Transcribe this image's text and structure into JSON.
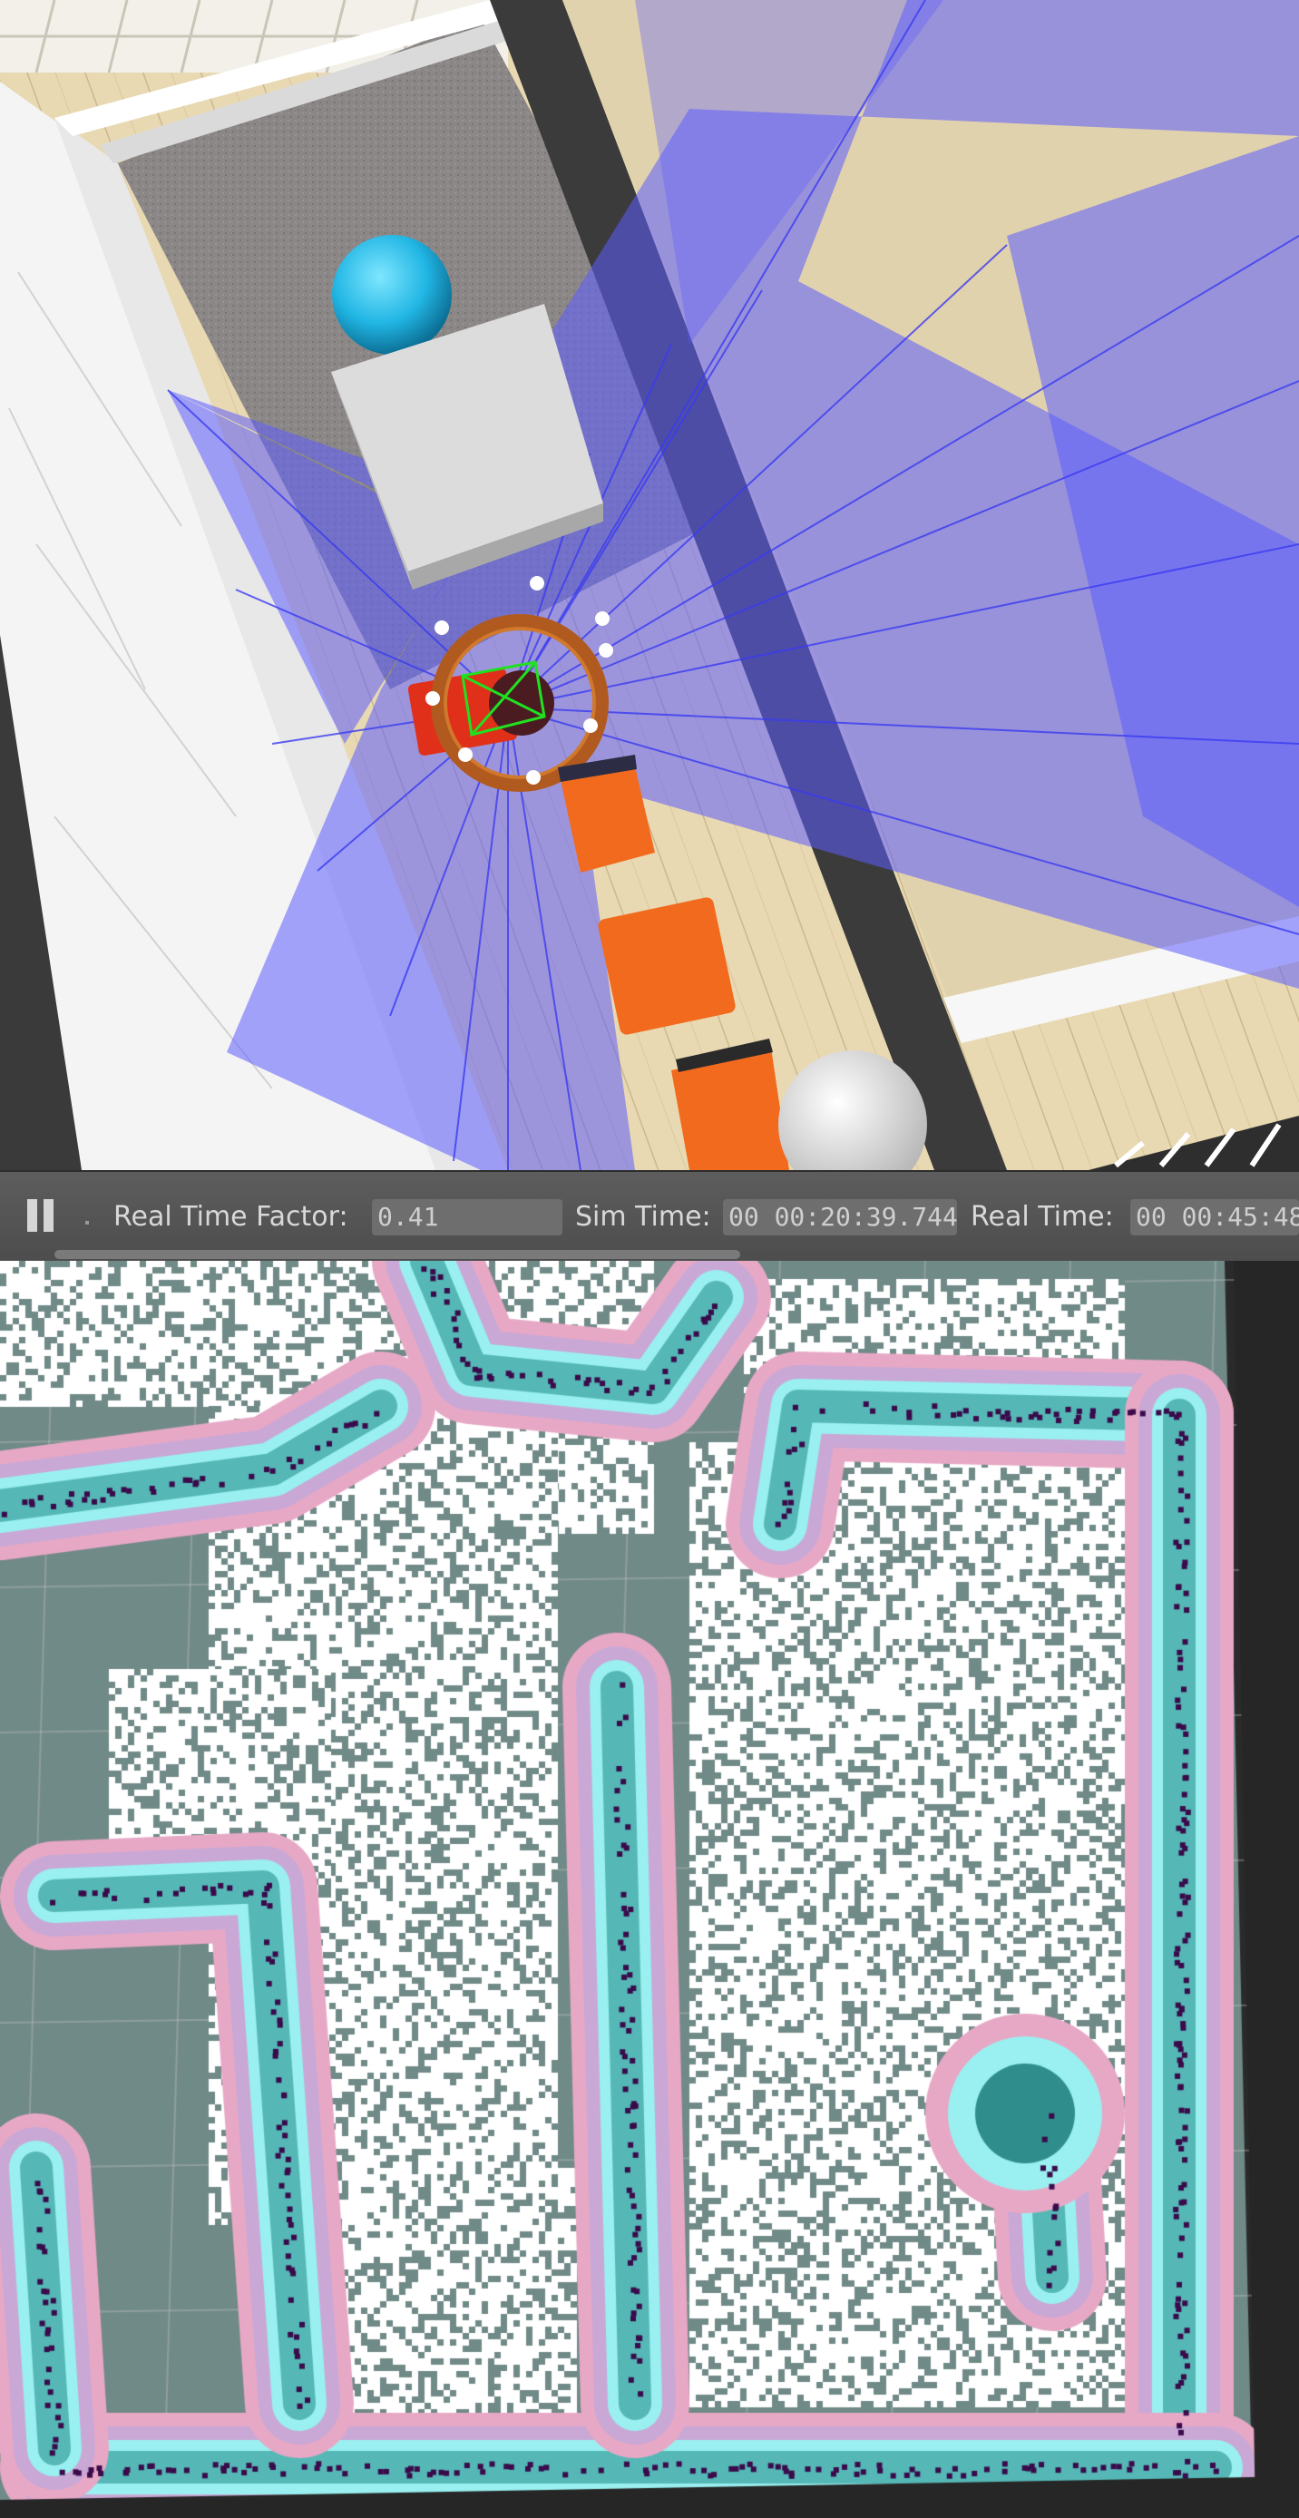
{
  "toolbar": {
    "pause_icon": "pause-icon",
    "real_time_factor_label": "Real Time Factor:",
    "real_time_factor_value": "0.41",
    "sim_time_label": "Sim Time:",
    "sim_time_value": "00 00:20:39.744",
    "real_time_label": "Real Time:",
    "real_time_value": "00 00:45:48"
  },
  "colors": {
    "laser": "#5d5dff",
    "obstacle_lethal": "#3a0a4a",
    "inscribed": "#9af0f0",
    "inflation": "#e7a8c6",
    "unknown": "#708a87",
    "free": "#ffffff",
    "robot": "#e0301a",
    "robot_ring": "#b05a20"
  }
}
